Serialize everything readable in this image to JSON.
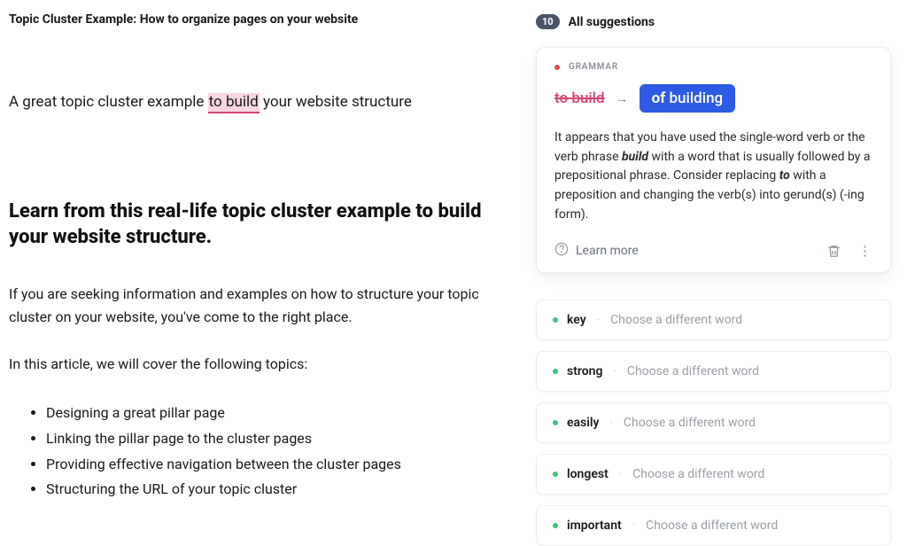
{
  "doc": {
    "title": "Topic Cluster Example: How to organize pages on your website",
    "subtitle_pre": "A great  topic cluster example ",
    "subtitle_hl": "to build",
    "subtitle_post": " your website structure",
    "heading": "Learn from this real-life topic cluster example to build your website structure.",
    "para1": "If you are seeking information and examples on how to structure your topic cluster on your website, you've come to the right place.",
    "para2": "In this article, we will cover the following topics:",
    "topics": [
      "Designing a great pillar page",
      "Linking the pillar page to the cluster pages",
      "Providing effective navigation between the cluster pages",
      "Structuring the URL of your topic cluster"
    ]
  },
  "panel": {
    "count": "10",
    "title": "All suggestions",
    "card": {
      "category": "GRAMMAR",
      "strike": "to build",
      "replacement_prefix": "of",
      "replacement_word": " building",
      "explain_1": "It appears that you have used the single-word verb or the verb phrase ",
      "explain_b1": "build",
      "explain_2": " with a word that is usually followed by a prepositional phrase. Consider replacing ",
      "explain_b2": "to",
      "explain_3": " with a preposition and changing the verb(s) into gerund(s) (-ing form).",
      "learn": "Learn more"
    },
    "hint": "Choose a different word",
    "suggestions": [
      {
        "word": "key"
      },
      {
        "word": "strong"
      },
      {
        "word": "easily"
      },
      {
        "word": "longest"
      },
      {
        "word": "important"
      }
    ]
  }
}
